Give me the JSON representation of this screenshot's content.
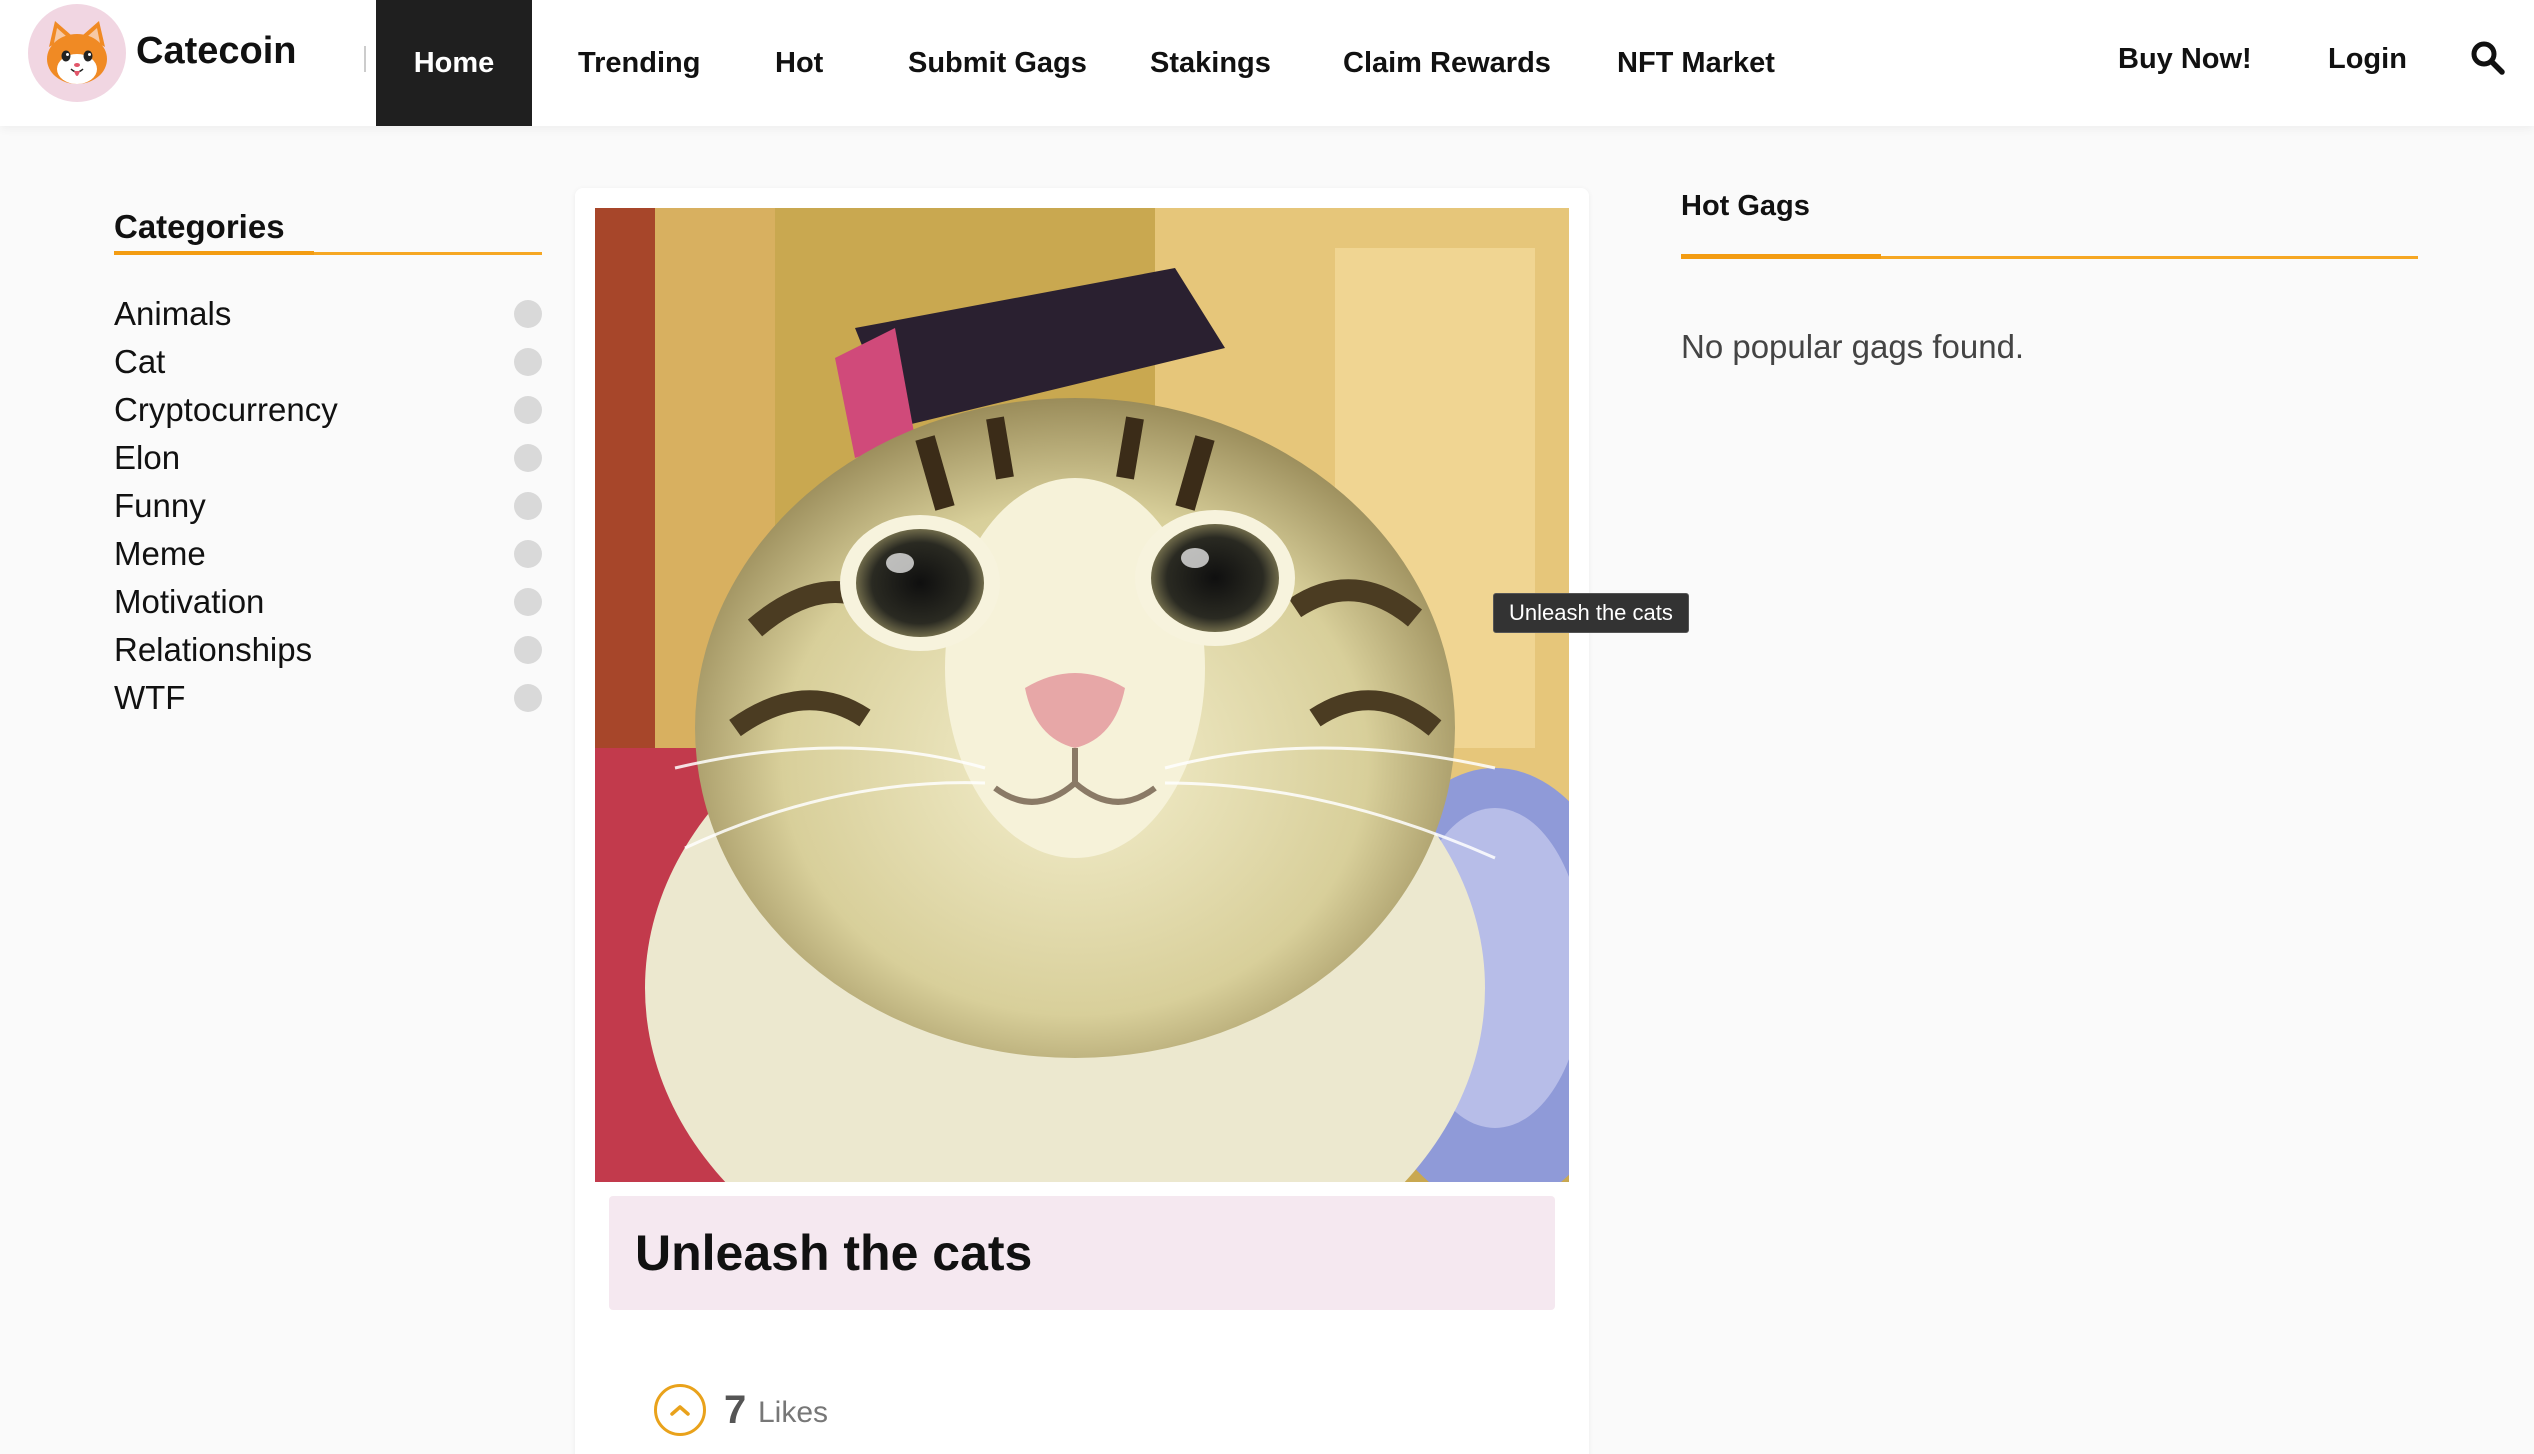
{
  "header": {
    "brand": "Catecoin",
    "nav": [
      "Home",
      "Trending",
      "Hot",
      "Submit Gags",
      "Stakings",
      "Claim Rewards",
      "NFT Market"
    ],
    "active_nav": "Home",
    "buy_label": "Buy Now!",
    "login_label": "Login",
    "search_icon": "search-icon",
    "logo_icon": "cat-face-icon"
  },
  "sidebar": {
    "title": "Categories",
    "items": [
      "Animals",
      "Cat",
      "Cryptocurrency",
      "Elon",
      "Funny",
      "Meme",
      "Motivation",
      "Relationships",
      "WTF"
    ]
  },
  "post": {
    "title": "Unleash the cats",
    "tooltip": "Unleash the cats",
    "likes": "7",
    "likes_label": "Likes",
    "like_icon": "chevron-up-icon"
  },
  "hot_gags": {
    "title": "Hot Gags",
    "empty_text": "No popular gags found."
  },
  "colors": {
    "accent": "#f39c12",
    "nav_active_bg": "#1f1f1f",
    "title_box_bg": "#f5e8f0"
  }
}
